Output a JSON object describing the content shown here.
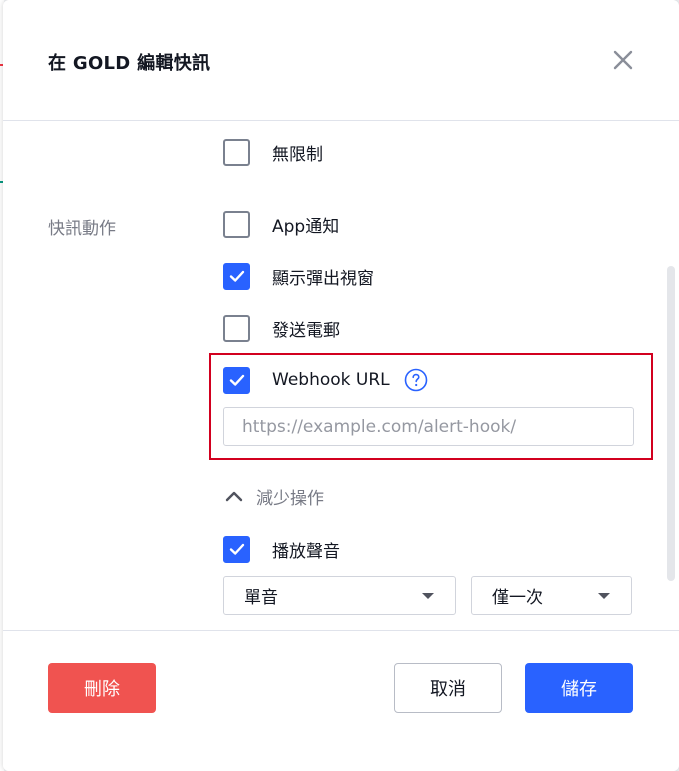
{
  "dialog": {
    "title": "在 GOLD 編輯快訊"
  },
  "actions": {
    "section_label": "快訊動作",
    "no_limit_label": "無限制",
    "app_notify_label": "App通知",
    "show_popup_label": "顯示彈出視窗",
    "send_email_label": "發送電郵",
    "webhook_label": "Webhook URL",
    "webhook_placeholder": "https://example.com/alert-hook/",
    "collapse_label": "減少操作",
    "play_sound_label": "播放聲音",
    "sound_select_value": "單音",
    "repeat_select_value": "僅一次"
  },
  "checkbox_states": {
    "no_limit": false,
    "app_notify": false,
    "show_popup": true,
    "send_email": false,
    "webhook": true,
    "play_sound": true
  },
  "footer": {
    "delete_label": "刪除",
    "cancel_label": "取消",
    "save_label": "儲存"
  },
  "colors": {
    "primary": "#2962ff",
    "danger": "#f05350",
    "highlight_border": "#d2001f",
    "muted_text": "#787b86"
  },
  "icons": {
    "close": "close-icon",
    "check": "check-icon",
    "help": "help-circle-icon",
    "chevron_up": "chevron-up-icon",
    "caret_down": "caret-down-icon"
  }
}
